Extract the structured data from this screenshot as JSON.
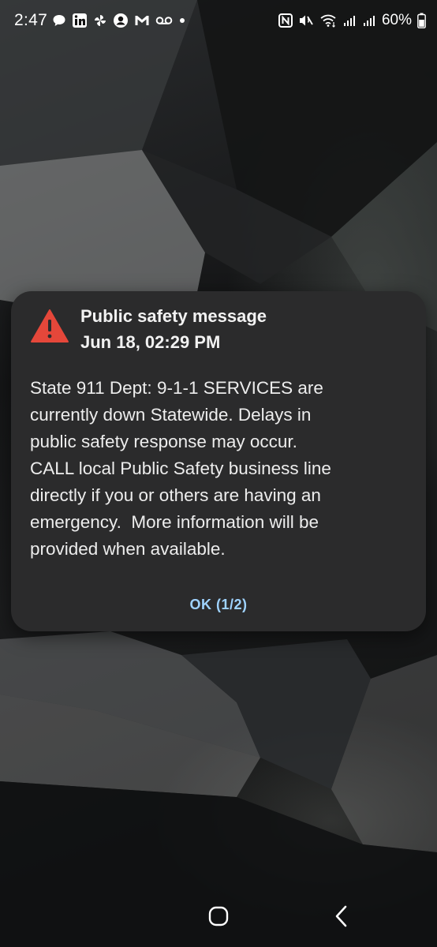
{
  "status_bar": {
    "time": "2:47",
    "battery": "60%",
    "left_icons": [
      "chat-bubble-icon",
      "linkedin-icon",
      "pinwheel-icon",
      "account-icon",
      "gmail-icon",
      "voicemail-icon",
      "dot-icon"
    ],
    "right_icons": [
      "nfc-icon",
      "mute-icon",
      "wifi-icon",
      "signal-icon",
      "signal-icon",
      "battery-icon"
    ]
  },
  "alert": {
    "title": "Public safety message",
    "date": "Jun 18, 02:29 PM",
    "body": "State 911 Dept: 9-1-1 SERVICES are\ncurrently down Statewide. Delays in\npublic safety response may occur.\nCALL local Public Safety business line\ndirectly if you or others are having an\nemergency.  More information will be\nprovided when available.",
    "ok_label": "OK  (1/2)",
    "icon": "warning-triangle-icon",
    "icon_color": "#e5473a",
    "button_color": "#9fd3ff"
  },
  "nav_bar": {
    "home_icon": "home-icon",
    "back_icon": "back-icon"
  }
}
